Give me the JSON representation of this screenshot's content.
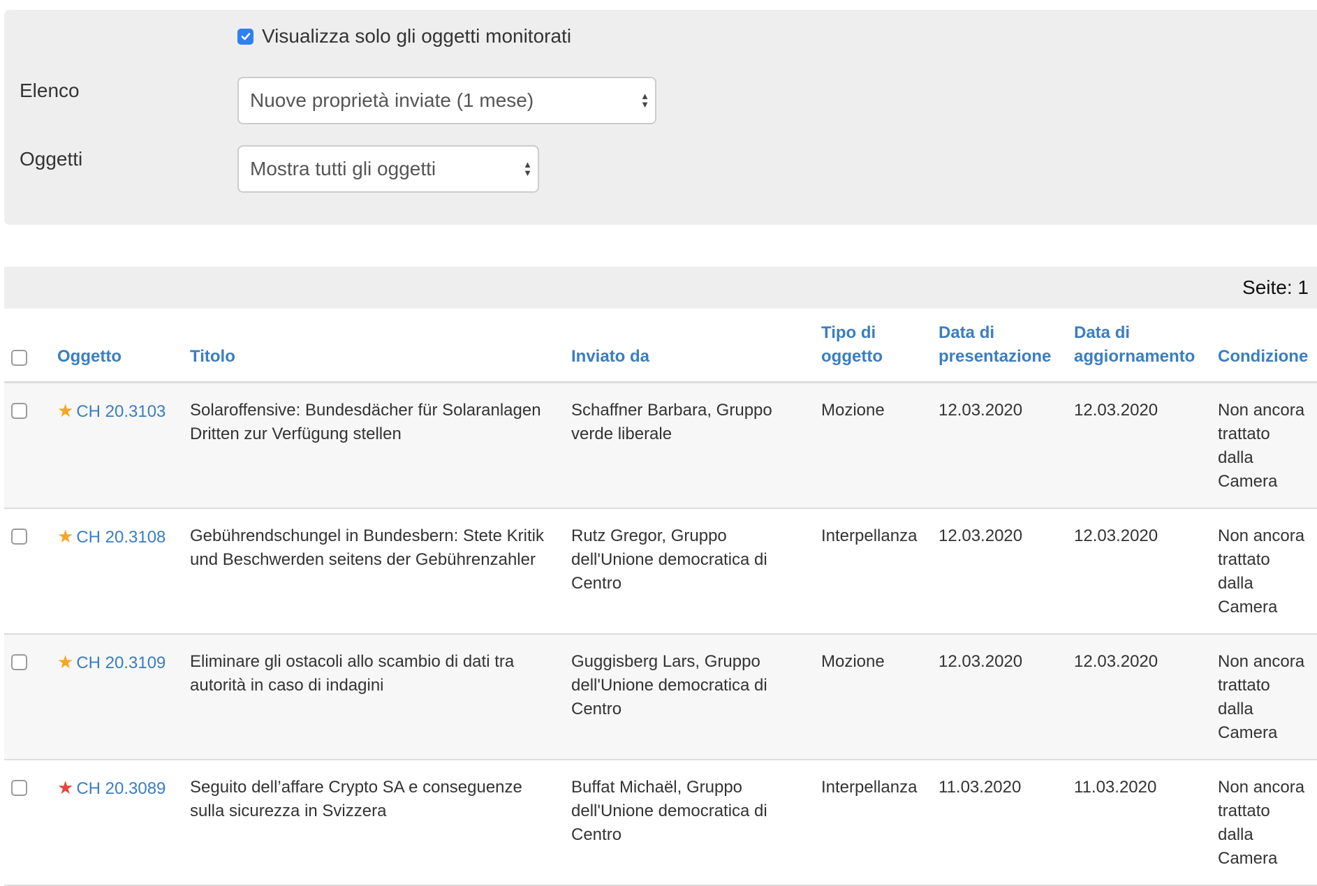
{
  "filters": {
    "monitor_checkbox_label": "Visualizza solo gli oggetti monitorati",
    "monitor_checked": true,
    "list_label": "Elenco",
    "list_selected": "Nuove proprietà inviate (1 mese)",
    "objects_label": "Oggetti",
    "objects_selected": "Mostra tutti gli oggetti"
  },
  "pager": {
    "text": "Seite: 1"
  },
  "colors": {
    "link": "#3a7ec2",
    "checkbox_accent": "#2f7ff5",
    "star_orange": "#f5a623",
    "star_red": "#e8453c"
  },
  "table": {
    "headers": {
      "object": "Oggetto",
      "title": "Titolo",
      "submitted_by": "Inviato da",
      "type_l1": "Tipo di",
      "type_l2": "oggetto",
      "date_pres_l1": "Data di",
      "date_pres_l2": "presentazione",
      "date_upd_l1": "Data di",
      "date_upd_l2": "aggiornamento",
      "status": "Condizione"
    },
    "rows": [
      {
        "star_icon": "star-orange-icon",
        "object": "CH 20.3103",
        "title": "Solaroffensive: Bundesdächer für Solaranlagen Dritten zur Verfügung stellen",
        "submitted_by": "Schaffner Barbara, Gruppo verde liberale",
        "type": "Mozione",
        "date_presented": "12.03.2020",
        "date_updated": "12.03.2020",
        "status": "Non ancora trattato dalla Camera"
      },
      {
        "star_icon": "star-orange-icon",
        "object": "CH 20.3108",
        "title": "Gebührendschungel in Bundesbern: Stete Kritik und Beschwerden seitens der Gebührenzahler",
        "submitted_by": "Rutz Gregor, Gruppo dell'Unione democratica di Centro",
        "type": "Interpellanza",
        "date_presented": "12.03.2020",
        "date_updated": "12.03.2020",
        "status": "Non ancora trattato dalla Camera"
      },
      {
        "star_icon": "star-orange-icon",
        "object": "CH 20.3109",
        "title": "Eliminare gli ostacoli allo scambio di dati tra autorità in caso di indagini",
        "submitted_by": "Guggisberg Lars, Gruppo dell'Unione democratica di Centro",
        "type": "Mozione",
        "date_presented": "12.03.2020",
        "date_updated": "12.03.2020",
        "status": "Non ancora trattato dalla Camera"
      },
      {
        "star_icon": "star-red-icon",
        "object": "CH 20.3089",
        "title": "Seguito dell’affare Crypto SA e conseguenze sulla sicurezza in Svizzera",
        "submitted_by": "Buffat Michaël, Gruppo dell'Unione democratica di Centro",
        "type": "Interpellanza",
        "date_presented": "11.03.2020",
        "date_updated": "11.03.2020",
        "status": "Non ancora trattato dalla Camera"
      }
    ]
  }
}
